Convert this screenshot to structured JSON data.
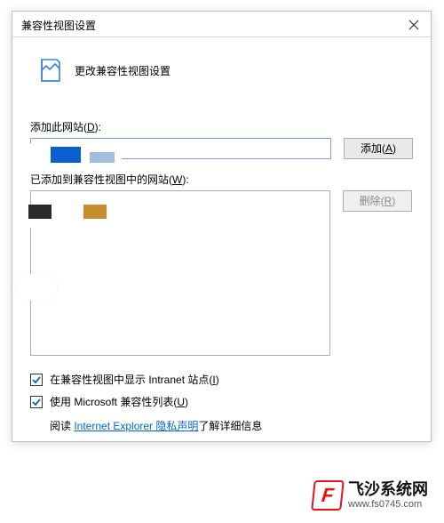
{
  "dialog": {
    "title": "兼容性视图设置",
    "subtitle": "更改兼容性视图设置",
    "add_label_prefix": "添加此网站(",
    "add_label_hotkey": "D",
    "add_label_suffix": "):",
    "add_btn_prefix": "添加(",
    "add_btn_hotkey": "A",
    "add_btn_suffix": ")",
    "list_label_prefix": "已添加到兼容性视图中的网站(",
    "list_label_hotkey": "W",
    "list_label_suffix": "):",
    "remove_btn_prefix": "删除(",
    "remove_btn_hotkey": "R",
    "remove_btn_suffix": ")",
    "cb_intranet_prefix": "在兼容性视图中显示 Intranet 站点(",
    "cb_intranet_hotkey": "I",
    "cb_intranet_suffix": ")",
    "cb_mslist_prefix": "使用 Microsoft 兼容性列表(",
    "cb_mslist_hotkey": "U",
    "cb_mslist_suffix": ")",
    "read_prefix": "阅读 ",
    "read_link": "Internet Explorer 隐私声明",
    "read_suffix": "了解详细信息"
  },
  "brand": {
    "title": "飞沙系统网",
    "url": "www.fs0745.com"
  }
}
